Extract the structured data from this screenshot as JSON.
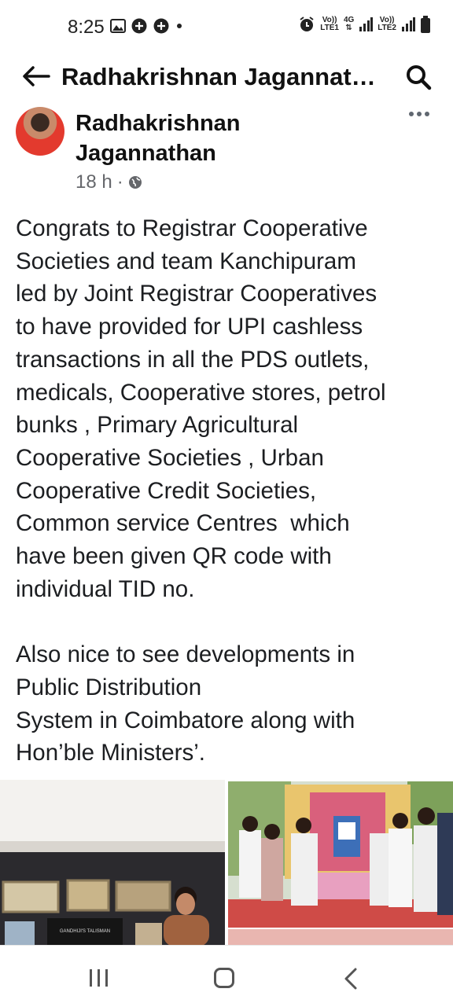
{
  "status_bar": {
    "time": "8:25",
    "left_icons": [
      "image-icon",
      "whatsapp-icon",
      "whatsapp-icon",
      "dot-icon"
    ],
    "sim1_top": "Vo))",
    "sim1_bottom": "LTE1",
    "net_top": "4G",
    "sim2_top": "Vo))",
    "sim2_bottom": "LTE2"
  },
  "app_bar": {
    "title": "Radhakrishnan Jagannat…"
  },
  "post": {
    "author_line1": "Radhakrishnan",
    "author_line2": "Jagannathan",
    "time": "18 h",
    "separator": "·",
    "body_lines": [
      "Congrats to Registrar Cooperative",
      "Societies and team Kanchipuram",
      "led by Joint Registrar Cooperatives",
      "to have provided for UPI cashless",
      "transactions in all the PDS outlets,",
      "medicals, Cooperative stores, petrol",
      "bunks , Primary Agricultural",
      "Cooperative Societies , Urban",
      "Cooperative Credit Societies,",
      "Common service Centres  which",
      "have been given QR code with",
      "individual TID no."
    ],
    "body_lines_2": [
      "Also nice to see developments in",
      "Public Distribution",
      "System in Coimbatore along with",
      "Hon’ble Ministers’."
    ]
  },
  "photos": {
    "left_sign": "GANDHIJI'S TALISMAN"
  }
}
